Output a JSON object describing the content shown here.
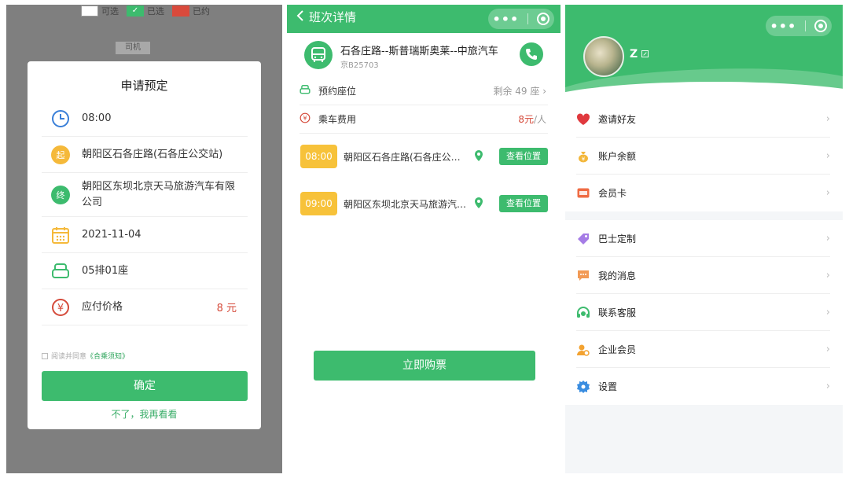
{
  "booking_panel": {
    "legend": [
      {
        "label": "可选",
        "color": "#ffffff"
      },
      {
        "label": "已选",
        "color": "#3dbb6e"
      },
      {
        "label": "已约",
        "color": "#d94a3c"
      }
    ],
    "driver_label": "司机",
    "dialog": {
      "title": "申请预定",
      "time": "08:00",
      "start_icon": "起",
      "start": "朝阳区石各庄路(石各庄公交站)",
      "end_icon": "终",
      "end": "朝阳区东坝北京天马旅游汽车有限公司",
      "date": "2021-11-04",
      "seat": "05排01座",
      "price_label": "应付价格",
      "price": "8 元",
      "agree_text": "阅读并同意",
      "agree_link": "《合乘须知》",
      "confirm_button": "确定",
      "later_button": "不了，我再看看"
    }
  },
  "trip_panel": {
    "header_title": "班次详情",
    "route_name": "石各庄路--斯普瑞斯奥莱--中旅汽车",
    "plate": "京B25703",
    "seat_label": "预约座位",
    "seat_value": "剩余 49 座",
    "fee_label": "乘车费用",
    "fee_amount": "8元",
    "fee_unit": "/人",
    "stops": [
      {
        "time": "08:00",
        "name": "朝阳区石各庄路(石各庄公…",
        "button": "查看位置"
      },
      {
        "time": "09:00",
        "name": "朝阳区东坝北京天马旅游汽…",
        "button": "查看位置"
      }
    ],
    "buy_button": "立即购票"
  },
  "profile_panel": {
    "username": "Z",
    "menu_group1": [
      {
        "label": "邀请好友",
        "icon": "heart-icon",
        "color": "#e0393e"
      },
      {
        "label": "账户余额",
        "icon": "money-bag-icon",
        "color": "#f3b73b"
      },
      {
        "label": "会员卡",
        "icon": "member-card-icon",
        "color": "#ef6b43"
      }
    ],
    "menu_group2": [
      {
        "label": "巴士定制",
        "icon": "tag-icon",
        "color": "#a57ce6"
      },
      {
        "label": "我的消息",
        "icon": "message-icon",
        "color": "#f29a55"
      },
      {
        "label": "联系客服",
        "icon": "headset-icon",
        "color": "#3dbb6e"
      },
      {
        "label": "企业会员",
        "icon": "enterprise-member-icon",
        "color": "#f3a230"
      },
      {
        "label": "设置",
        "icon": "gear-icon",
        "color": "#3a8de0"
      }
    ]
  }
}
